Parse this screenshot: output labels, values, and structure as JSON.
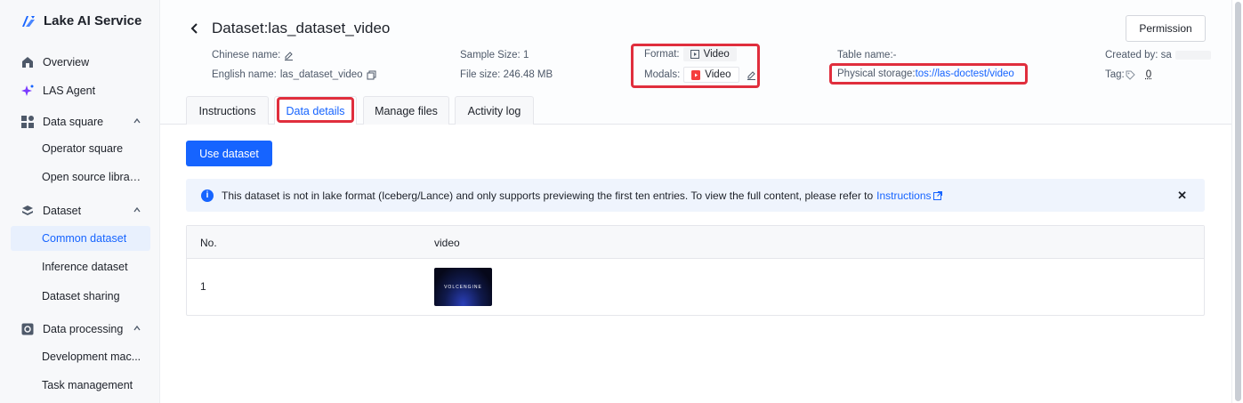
{
  "brand": {
    "name": "Lake AI Service"
  },
  "sidebar": {
    "items": [
      {
        "label": "Overview",
        "icon": "overview-icon"
      },
      {
        "label": "LAS Agent",
        "icon": "sparkle-icon"
      },
      {
        "label": "Data square",
        "icon": "grid-icon"
      },
      {
        "label": "Operator square"
      },
      {
        "label": "Open source librar..."
      },
      {
        "label": "Dataset",
        "icon": "layers-icon"
      },
      {
        "label": "Common dataset"
      },
      {
        "label": "Inference dataset"
      },
      {
        "label": "Dataset sharing"
      },
      {
        "label": "Data processing",
        "icon": "gear-icon"
      },
      {
        "label": "Development mac..."
      },
      {
        "label": "Task management"
      }
    ]
  },
  "header": {
    "title": "Dataset:las_dataset_video",
    "permission_label": "Permission",
    "chinese_name_label": "Chinese name:",
    "english_name_label": "English name:",
    "english_name_value": "las_dataset_video",
    "sample_size": "Sample Size: 1",
    "file_size": "File size: 246.48 MB",
    "format_label": "Format:",
    "format_value": "Video",
    "modals_label": "Modals:",
    "modals_value": "Video",
    "table_name": "Table name:-",
    "physical_storage_label": "Physical storage:",
    "physical_storage_value": "tos://las-doctest/video",
    "created_by": "Created by: sa",
    "tag_label": "Tag:",
    "tag_value": "0"
  },
  "tabs": [
    {
      "label": "Instructions"
    },
    {
      "label": "Data details"
    },
    {
      "label": "Manage files"
    },
    {
      "label": "Activity log"
    }
  ],
  "use_dataset_label": "Use dataset",
  "alert": {
    "text": "This dataset is not in lake format (Iceberg/Lance) and only supports previewing the first ten entries. To view the full content, please refer to",
    "link": "Instructions"
  },
  "table": {
    "columns": [
      "No.",
      "video"
    ],
    "rows": [
      {
        "no": "1",
        "video_caption": "VOLCENGINE"
      }
    ]
  },
  "colors": {
    "accent": "#1664ff",
    "highlight": "#e02e3d"
  }
}
